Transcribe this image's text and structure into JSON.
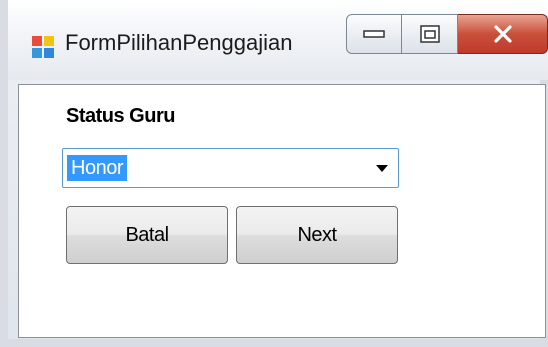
{
  "window": {
    "title": "FormPilihanPenggajian",
    "icon": "form-app-icon",
    "caption_buttons": {
      "minimize_icon": "minimize-icon",
      "maximize_icon": "maximize-icon",
      "close_icon": "close-icon"
    }
  },
  "form": {
    "status_label": "Status Guru",
    "status_select": {
      "value": "Honor",
      "arrow_icon": "chevron-down-icon"
    },
    "batal_label": "Batal",
    "next_label": "Next"
  },
  "colors": {
    "selection": "#3399ff",
    "close_button": "#c0392b",
    "combo_border": "#5b9bd5"
  }
}
